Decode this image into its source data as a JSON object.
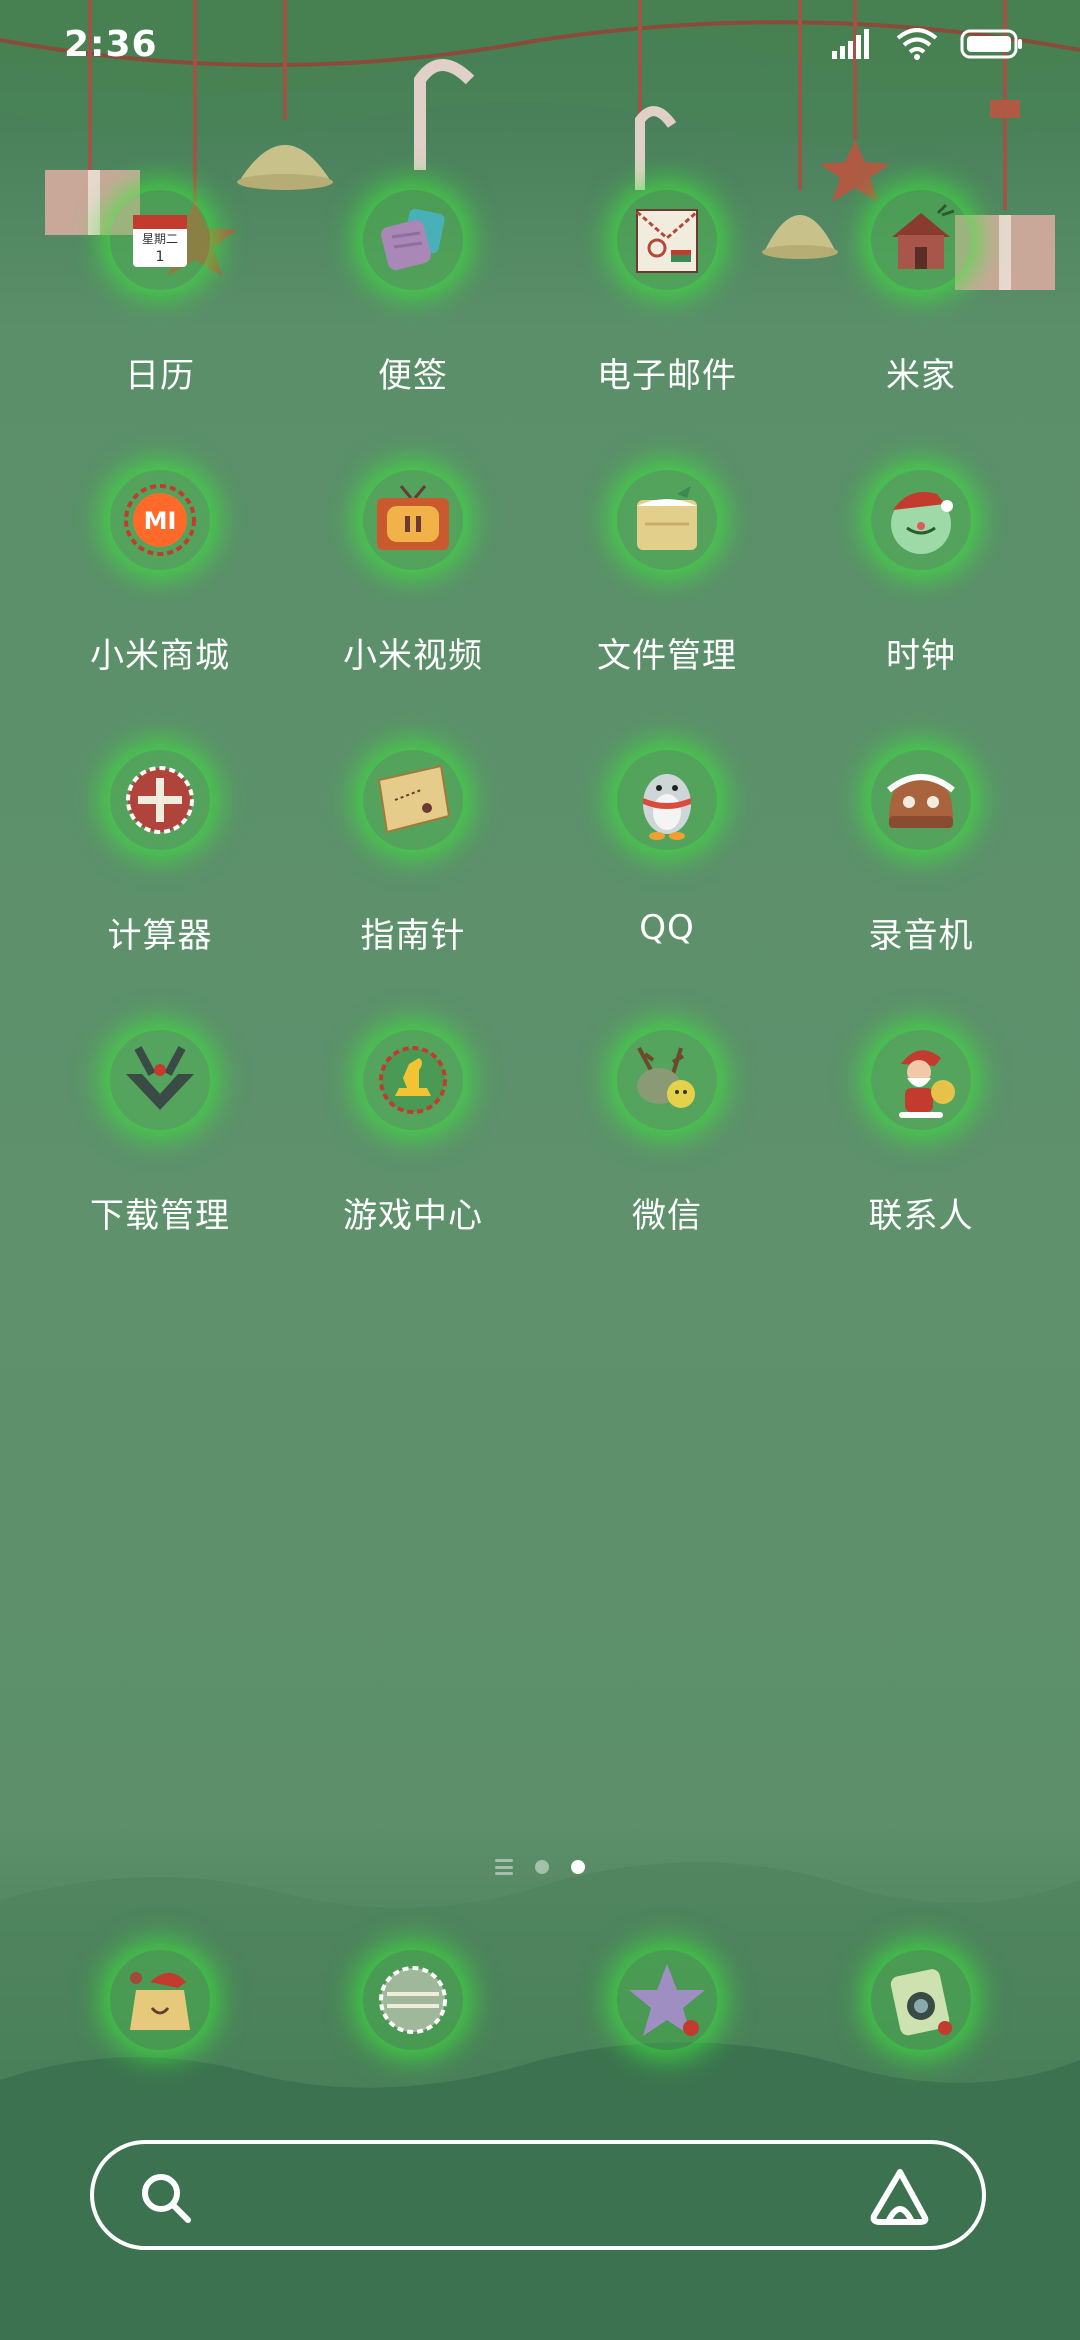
{
  "status_bar": {
    "time": "2:36",
    "icons": [
      "signal-icon",
      "wifi-icon",
      "battery-icon"
    ],
    "battery_level": 1.0
  },
  "apps": [
    {
      "label": "日历",
      "icon": "calendar-icon",
      "calendar_weekday": "星期二",
      "calendar_day": "1"
    },
    {
      "label": "便签",
      "icon": "notes-icon"
    },
    {
      "label": "电子邮件",
      "icon": "email-icon"
    },
    {
      "label": "米家",
      "icon": "mijia-house-icon"
    },
    {
      "label": "小米商城",
      "icon": "mi-store-icon",
      "badge_text": "MI"
    },
    {
      "label": "小米视频",
      "icon": "tv-video-icon"
    },
    {
      "label": "文件管理",
      "icon": "file-manager-icon"
    },
    {
      "label": "时钟",
      "icon": "clock-icon"
    },
    {
      "label": "计算器",
      "icon": "calculator-icon"
    },
    {
      "label": "指南针",
      "icon": "compass-map-icon"
    },
    {
      "label": "QQ",
      "icon": "qq-penguin-icon"
    },
    {
      "label": "录音机",
      "icon": "recorder-icon"
    },
    {
      "label": "下载管理",
      "icon": "download-manager-icon"
    },
    {
      "label": "游戏中心",
      "icon": "game-center-icon"
    },
    {
      "label": "微信",
      "icon": "wechat-icon"
    },
    {
      "label": "联系人",
      "icon": "contacts-santa-icon"
    }
  ],
  "page_indicator": {
    "pages": 2,
    "active_index": 1
  },
  "dock": [
    {
      "icon": "phone-bag-icon"
    },
    {
      "icon": "messages-ornament-icon"
    },
    {
      "icon": "browser-star-icon"
    },
    {
      "icon": "camera-icon"
    }
  ],
  "search": {
    "icon": "search-icon",
    "assistant_icon": "assistant-icon"
  },
  "colors": {
    "background": "#5e916c",
    "glow": "#3ce63c",
    "text": "#ffffff"
  }
}
